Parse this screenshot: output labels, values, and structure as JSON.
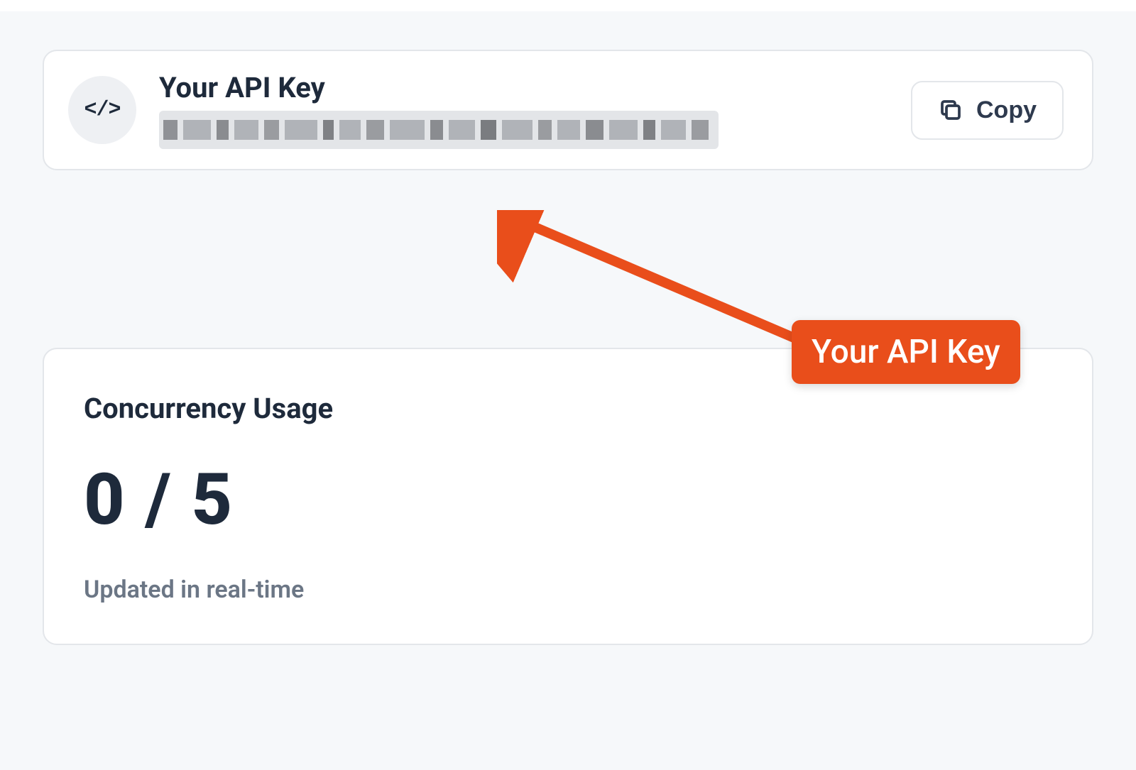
{
  "api_key_section": {
    "label": "Your API Key",
    "copy_button_label": "Copy",
    "icon_name": "code-icon"
  },
  "annotation": {
    "label": "Your API Key"
  },
  "concurrency_section": {
    "title": "Concurrency Usage",
    "value": "0 / 5",
    "note": "Updated in real-time"
  }
}
